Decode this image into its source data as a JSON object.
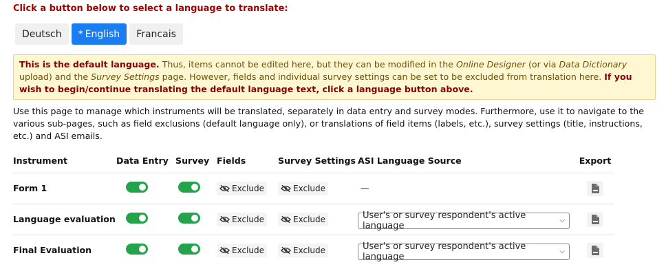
{
  "prompt": "Click a button below to select a language to translate:",
  "languages": [
    {
      "label": "Deutsch",
      "active": false
    },
    {
      "label": "English",
      "active": true
    },
    {
      "label": "Francais",
      "active": false
    }
  ],
  "active_marker": "*",
  "alert": {
    "b1": "This is the default language.",
    "t1": " Thus, items cannot be edited here, but they can be modified in the ",
    "i1": "Online Designer",
    "t2": " (or via ",
    "i2": "Data Dictionary",
    "t3": " upload) and the ",
    "i3": "Survey Settings",
    "t4": " page. However, fields and individual survey settings can be set to be excluded from translation here. ",
    "b2": "If you wish to begin/continue translating the default language text, click a language button above."
  },
  "description": "Use this page to manage which instruments will be translated, separately in data entry and survey modes. Furthermore, use it to navigate to the various sub-pages, such as field exclusions (default language only), or translations of field items (labels, etc.), survey settings (title, instructions, etc.) and ASI emails.",
  "table": {
    "headers": {
      "instrument": "Instrument",
      "data_entry": "Data Entry",
      "survey": "Survey",
      "fields": "Fields",
      "survey_settings": "Survey Settings",
      "asi": "ASI Language Source",
      "export": "Export"
    },
    "rows": [
      {
        "name": "Form 1",
        "fields_btn": "Exclude",
        "ss_btn": "Exclude",
        "asi_text": "—",
        "asi_select": null
      },
      {
        "name": "Language evaluation",
        "fields_btn": "Exclude",
        "ss_btn": "Exclude",
        "asi_text": null,
        "asi_select": "User's or survey respondent's active language"
      },
      {
        "name": "Final Evaluation",
        "fields_btn": "Exclude",
        "ss_btn": "Exclude",
        "asi_text": null,
        "asi_select": "User's or survey respondent's active language"
      }
    ]
  },
  "colors": {
    "accent": "#1a7df0",
    "toggle_on": "#23a34a",
    "prompt": "#a30000"
  }
}
